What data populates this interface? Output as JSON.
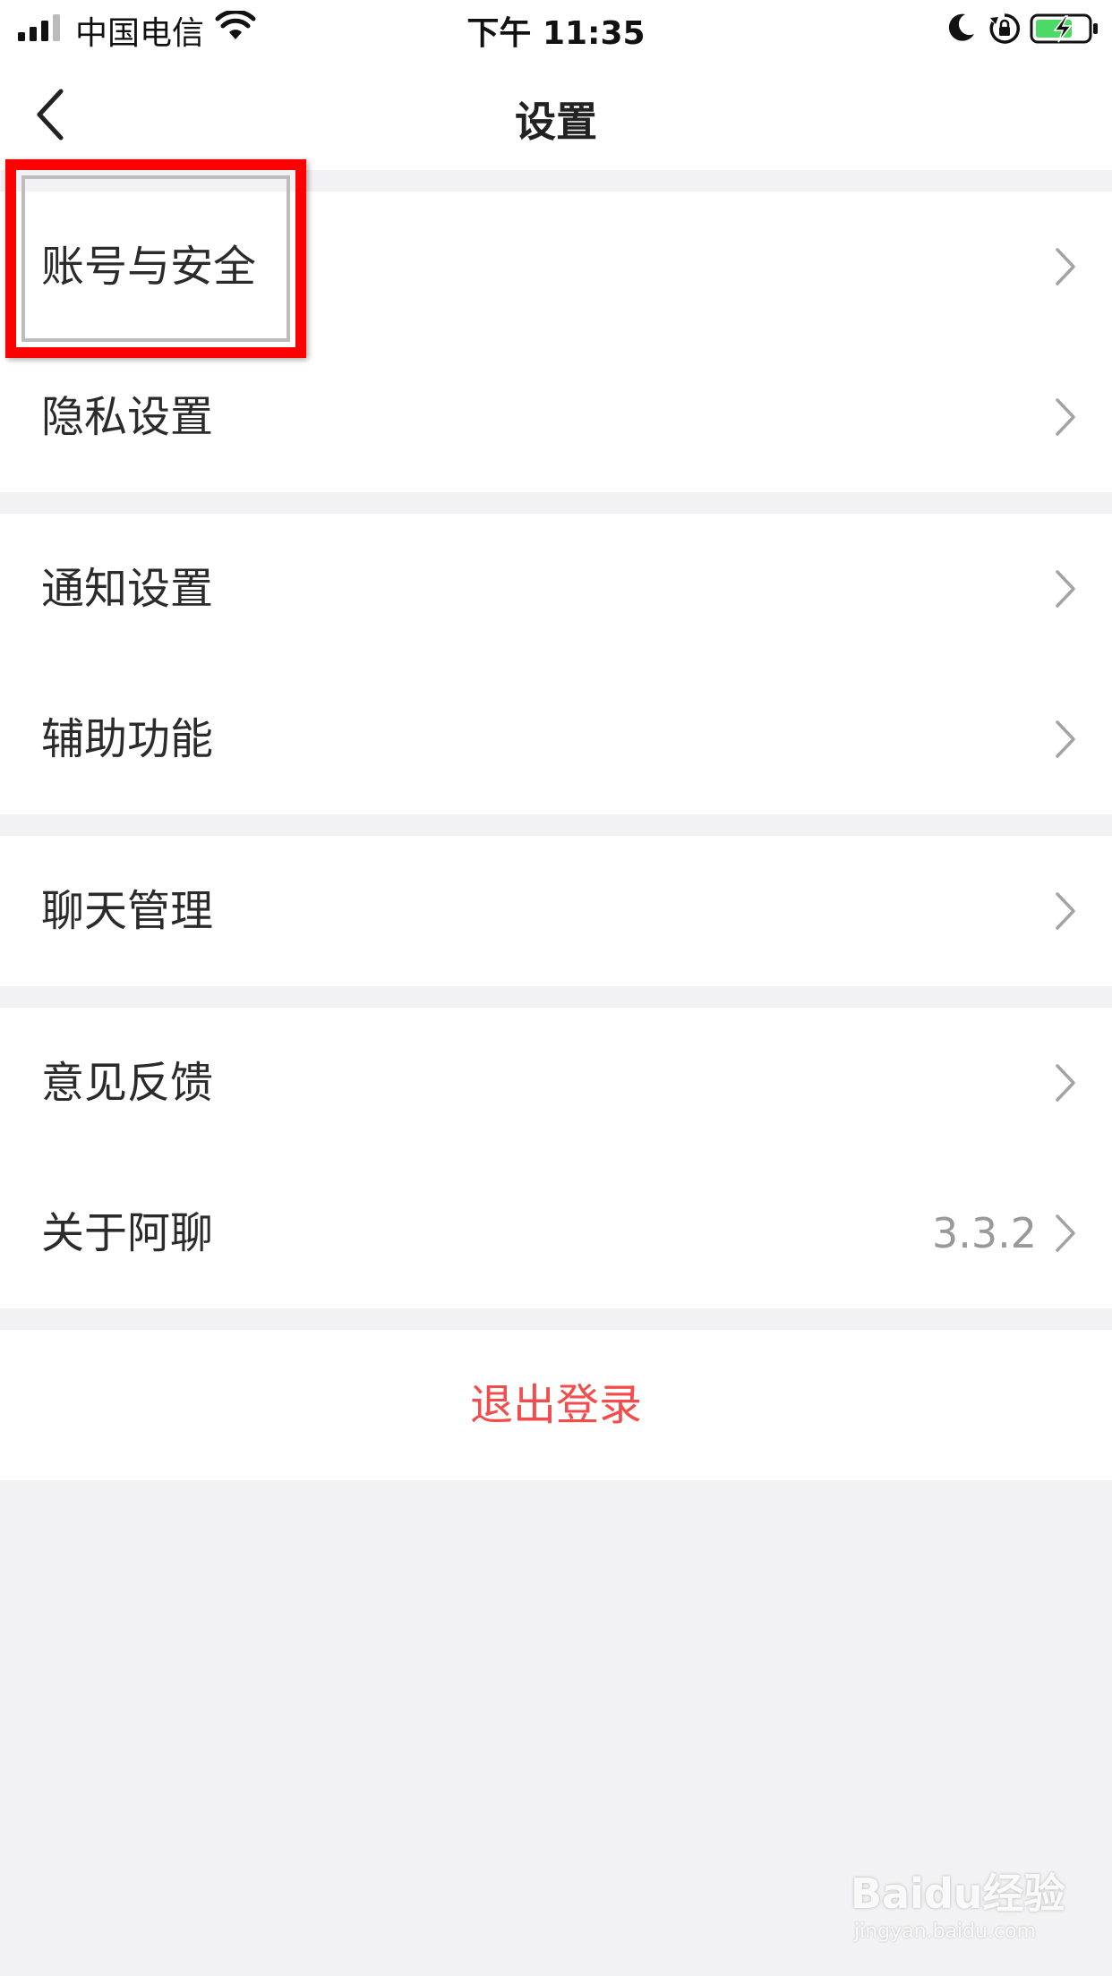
{
  "status_bar": {
    "carrier": "中国电信",
    "time": "下午 11:35",
    "icons": [
      "signal-icon",
      "wifi-icon",
      "moon-icon",
      "rotation-lock-icon",
      "battery-charging-icon"
    ]
  },
  "nav": {
    "title": "设置",
    "back_icon": "chevron-left-icon"
  },
  "groups": [
    {
      "items": [
        {
          "label": "账号与安全"
        },
        {
          "label": "隐私设置"
        }
      ]
    },
    {
      "items": [
        {
          "label": "通知设置"
        },
        {
          "label": "辅助功能"
        }
      ]
    },
    {
      "items": [
        {
          "label": "聊天管理"
        }
      ]
    },
    {
      "items": [
        {
          "label": "意见反馈"
        },
        {
          "label": "关于阿聊",
          "value": "3.3.2"
        }
      ]
    }
  ],
  "logout": {
    "label": "退出登录"
  },
  "watermark": {
    "logo_text": "Baidu经验",
    "url_text": "jingyan.baidu.com"
  },
  "colors": {
    "background": "#f2f2f4",
    "logout_red": "#f24d4d",
    "highlight_red": "#ff0000",
    "battery_green": "#4cd964"
  }
}
